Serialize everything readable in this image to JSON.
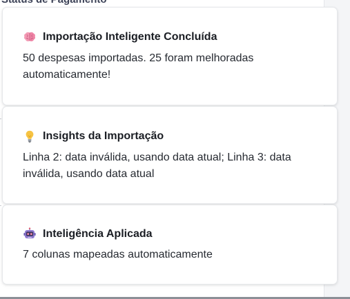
{
  "background": {
    "heading": "Status de Pagamento"
  },
  "toasts": [
    {
      "icon": "brain-icon",
      "title": "Importação Inteligente Concluída",
      "message": "50 despesas importadas. 25 foram melhoradas automaticamente!"
    },
    {
      "icon": "lightbulb-icon",
      "title": "Insights da Importação",
      "message": "Linha 2: data inválida, usando data atual; Linha 3: data inválida, usando data atual"
    },
    {
      "icon": "robot-icon",
      "title": "Inteligência Aplicada",
      "message": "7 colunas mapeadas automaticamente"
    }
  ],
  "colors": {
    "brain": "#f39ab4",
    "lightbulb": "#f6c343",
    "robot": "#8f7ad1"
  }
}
